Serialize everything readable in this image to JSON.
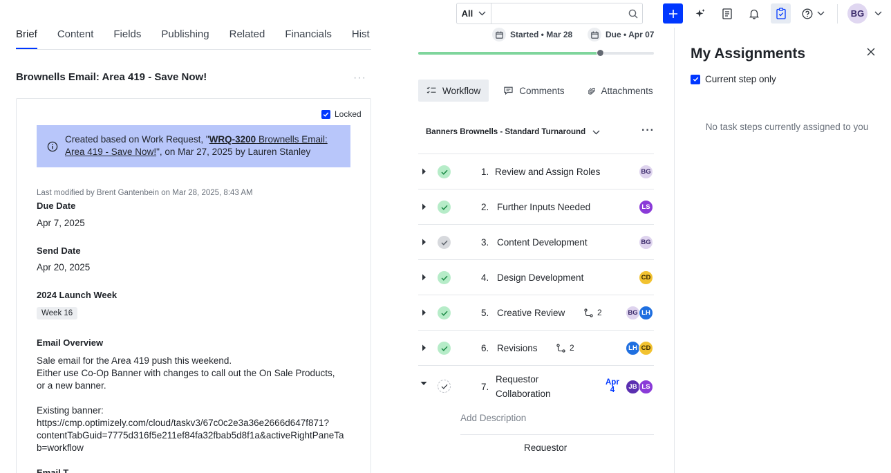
{
  "search": {
    "scope": "All",
    "placeholder": ""
  },
  "user": {
    "initials": "BG"
  },
  "tabs": [
    "Brief",
    "Content",
    "Fields",
    "Publishing",
    "Related",
    "Financials",
    "Hist"
  ],
  "doc": {
    "title": "Brownells Email: Area 419 - Save Now!",
    "more": "···",
    "locked_label": "Locked",
    "banner": {
      "prefix": "Created based on Work Request, \"",
      "wrq_id": "WRQ-3200",
      "wrq_title": " Brownells Email: Area 419 - Save Now!",
      "suffix": "\", on Mar 27, 2025 by Lauren Stanley"
    },
    "last_modified": "Last modified by Brent Gantenbein on Mar 28, 2025, 8:43 AM",
    "fields": {
      "due_date_label": "Due Date",
      "due_date": "Apr 7, 2025",
      "send_date_label": "Send Date",
      "send_date": "Apr 20, 2025",
      "launch_week_label": "2024 Launch Week",
      "launch_week": "Week 16",
      "overview_label": "Email Overview",
      "overview": "Sale email for the Area 419 push this weekend.\nEither use Co-Op Banner with changes to call out the On Sale Products,\nor a new banner.\n\nExisting banner:\nhttps://cmp.optimizely.com/cloud/taskv3/67c0c2e3a36e2666d647f871?\ncontentTabGuid=7775d316f5e211ef84fa32fbab5d8f1a&activeRightPaneTa\nb=workflow",
      "next_label": "Email T"
    }
  },
  "dates": {
    "started": "Started • Mar 28",
    "due": "Due • Apr 07"
  },
  "progress": {
    "fraction": 0.77
  },
  "mid_tabs": {
    "workflow": "Workflow",
    "comments": "Comments",
    "attachments": "Attachments"
  },
  "workflow": {
    "name": "Banners Brownells - Standard Turnaround",
    "more": "···",
    "steps": [
      {
        "num": "1.",
        "name": "Review and Assign Roles",
        "status": "done",
        "avatars": [
          "BG"
        ]
      },
      {
        "num": "2.",
        "name": "Further Inputs Needed",
        "status": "done",
        "avatars": [
          "LS"
        ]
      },
      {
        "num": "3.",
        "name": "Content Development",
        "status": "pending",
        "avatars": [
          "BG"
        ]
      },
      {
        "num": "4.",
        "name": "Design Development",
        "status": "done",
        "avatars": [
          "CD"
        ]
      },
      {
        "num": "5.",
        "name": "Creative Review",
        "status": "done",
        "subtasks": "2",
        "avatars": [
          "BG",
          "LH"
        ]
      },
      {
        "num": "6.",
        "name": "Revisions",
        "status": "done",
        "subtasks": "2",
        "avatars": [
          "LH",
          "CD"
        ]
      },
      {
        "num": "7.",
        "name": "Requestor",
        "name2": "Collaboration",
        "status": "open",
        "due_month": "Apr",
        "due_day": "4",
        "avatars": [
          "JB",
          "LS"
        ]
      }
    ],
    "add_description": "Add Description",
    "sub_step_name": "Requestor"
  },
  "panel": {
    "title": "My Assignments",
    "current_step_label": "Current step only",
    "empty": "No task steps currently assigned to you"
  }
}
